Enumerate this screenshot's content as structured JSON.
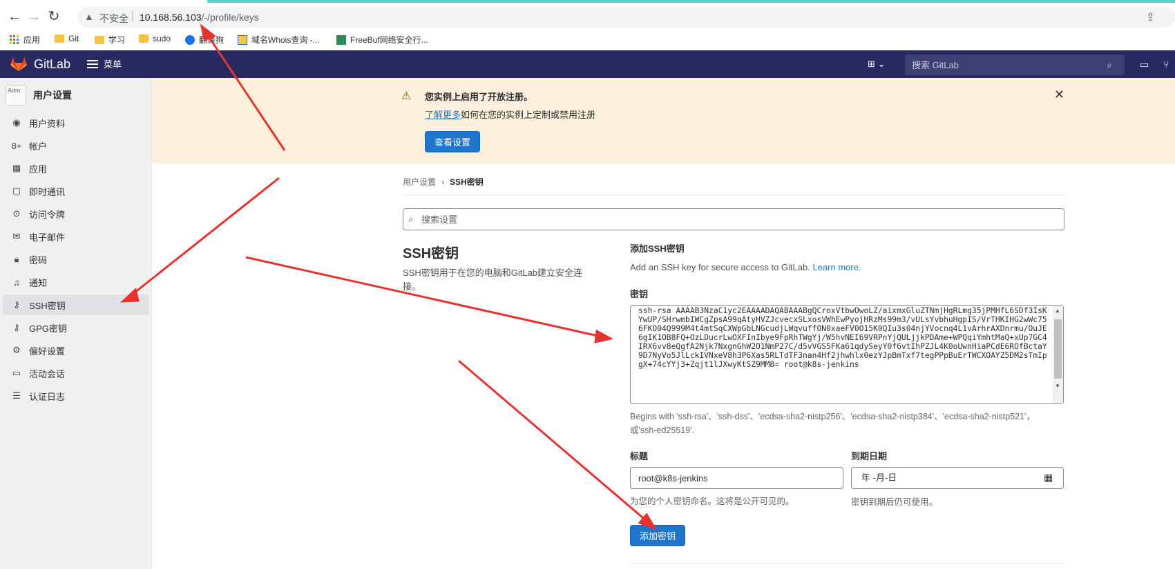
{
  "browser": {
    "insecure_label": "不安全",
    "url_host": "10.168.56.103",
    "url_path": "/-/profile/keys",
    "bookmarks": [
      {
        "label": "应用",
        "icon": "apps-grid-icon"
      },
      {
        "label": "Git",
        "icon": "folder-icon"
      },
      {
        "label": "学习",
        "icon": "folder-icon"
      },
      {
        "label": "sudo",
        "icon": "folder-icon"
      },
      {
        "label": "翻译狗",
        "icon": "bookmark-favicon"
      },
      {
        "label": "域名Whois查询 -...",
        "icon": "bookmark-favicon"
      },
      {
        "label": "FreeBuf网络安全行...",
        "icon": "bookmark-favicon"
      }
    ]
  },
  "header": {
    "brand": "GitLab",
    "menu_label": "菜单",
    "search_placeholder": "搜索 GitLab",
    "bg_color": "#292961"
  },
  "sidebar": {
    "title": "用户设置",
    "avatar_alt": "Adm",
    "items": [
      {
        "label": "用户资料",
        "icon": "user-icon"
      },
      {
        "label": "帐户",
        "icon": "account-icon"
      },
      {
        "label": "应用",
        "icon": "applications-icon"
      },
      {
        "label": "即时通讯",
        "icon": "chat-icon"
      },
      {
        "label": "访问令牌",
        "icon": "token-icon"
      },
      {
        "label": "电子邮件",
        "icon": "mail-icon"
      },
      {
        "label": "密码",
        "icon": "lock-icon"
      },
      {
        "label": "通知",
        "icon": "notifications-icon"
      },
      {
        "label": "SSH密钥",
        "icon": "key-icon",
        "active": true
      },
      {
        "label": "GPG密钥",
        "icon": "key-icon"
      },
      {
        "label": "偏好设置",
        "icon": "preferences-icon"
      },
      {
        "label": "活动会话",
        "icon": "monitor-icon"
      },
      {
        "label": "认证日志",
        "icon": "log-icon"
      }
    ]
  },
  "banner": {
    "title": "您实例上启用了开放注册。",
    "link_text": "了解更多",
    "line_rest": "如何在您的实例上定制或禁用注册",
    "button": "查看设置"
  },
  "breadcrumb": {
    "parent": "用户设置",
    "current": "SSH密钥"
  },
  "settings_search_placeholder": "搜索设置",
  "section": {
    "title": "SSH密钥",
    "description": "SSH密钥用于在您的电脑和GitLab建立安全连接。"
  },
  "form": {
    "add_title": "添加SSH密钥",
    "add_desc": "Add an SSH key for secure access to GitLab.",
    "learn_more": "Learn more.",
    "key_label": "密钥",
    "key_value": "ssh-rsa AAAAB3NzaC1yc2EAAAADAQABAAABgQCroxVtbwOwoLZ/aixmxGluZTNmjHgRLmg35jPMHfL6SDf3IsKYwUP/SHrwmbIWCgZpsA99qAtyHVZJcvecxSLxosVWhEwPyojHRzMs99m3/vULsYvbhuHgpIS/VrTHKIHG2wWc756FKO04Q999M4t4mtSqCXWpGbLNGcudjLWqvuffON0xaeFV0O15K0QIu3s04njYVocnq4L1vArhrAXDnrmu/OuJE6gIK1OB8FQ+OzLDucrLwOXFInIbye9FpRhTWgYj/W5hvNEI69VRPnYjQULjjkPDAme+WPQqiYmhtMaQ+xUp7GC4IRX6vv8eQgfA2Njk7NxgnGhW2O1NmP27C/d5vVGS5FKa61qdySeyY0f6vtIhPZJL4K0oUwnHiaPCdE6ROfBctaY9D7NyVo5JlLckIVNxeV8h3P6Xas5RLTdTF3nan4Hf2jhwhlx0ezYJpBmTxf7tegPPpBuErTWCXOAYZ5DM2sTmIpgX+74cYYj3+Zqjt1lJXwyKtSZ9MM8= root@k8s-jenkins",
    "key_hint": "Begins with 'ssh-rsa'、'ssh-dss'、'ecdsa-sha2-nistp256'、'ecdsa-sha2-nistp384'、'ecdsa-sha2-nistp521'，或'ssh-ed25519'.",
    "title_label": "标题",
    "title_value": "root@k8s-jenkins",
    "title_hint": "为您的个人密钥命名。这将是公开可见的。",
    "expires_label": "到期日期",
    "expires_placeholder": "年 -月-日",
    "expires_hint": "密钥到期后仍可使用。",
    "submit": "添加密钥"
  },
  "colors": {
    "primary": "#1f75cb",
    "banner_bg": "#fdf1dd",
    "annotation_arrow": "#e8322e"
  }
}
